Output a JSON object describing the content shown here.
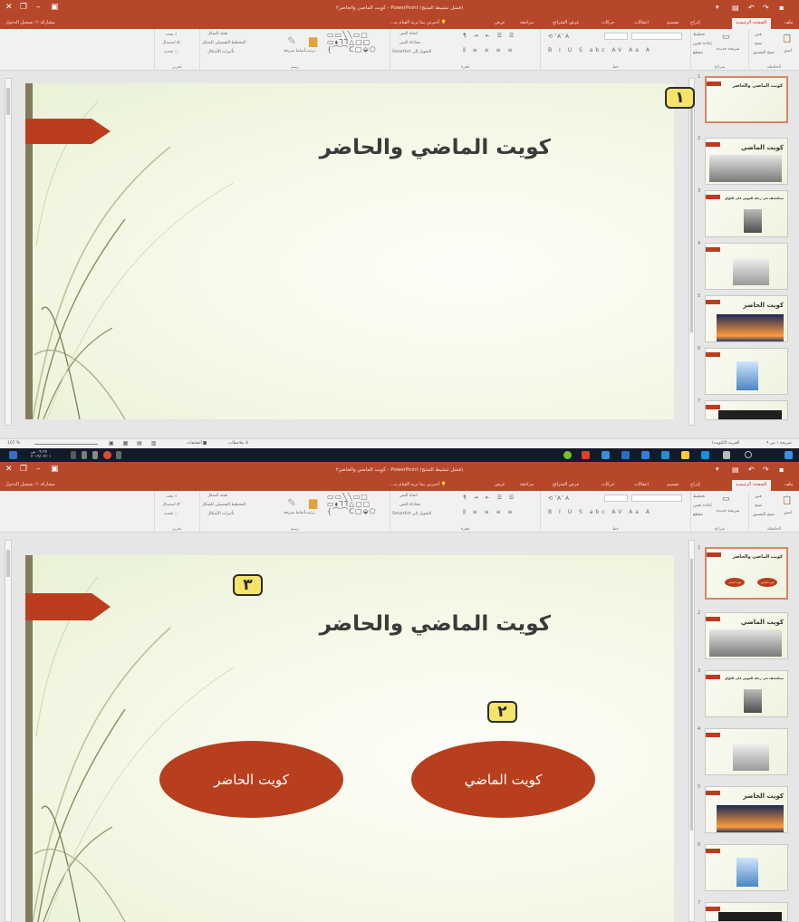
{
  "app": {
    "window_title": "كويت الماضي والحاضر۲ - PowerPoint (فشل تنشيط المنتج)",
    "sign_in": "تسجيل الدخول",
    "share": "مشاركة",
    "tell_me": "أخبرني بما تريد القيام به...",
    "file_tab": "ملف",
    "tabs": [
      "الصفحة الرئيسية",
      "إدراج",
      "تصميم",
      "انتقالات",
      "حركات",
      "عرض الشرائح",
      "مراجعة",
      "عرض"
    ]
  },
  "ribbon": {
    "groups": [
      "الحافظة",
      "شرائح",
      "خط",
      "فقرة",
      "رسم",
      "تحرير"
    ],
    "clipboard": {
      "paste": "لصق",
      "cut": "قص",
      "copy": "نسخ",
      "format_painter": "نسخ التنسيق"
    },
    "slides": {
      "new_slide": "شريحة جديدة",
      "layout": "تخطيط",
      "reset": "إعادة تعيين",
      "section": "مقطع"
    },
    "paragraph": {
      "text_direction": "اتجاه النص",
      "align_text": "محاذاة النص",
      "convert_smartart": "التحويل إلى SmartArt"
    },
    "drawing": {
      "arrange": "ترتيب",
      "quick_styles": "أنماط سريعة",
      "shape_fill": "تعبئة الشكل",
      "shape_outline": "المخطط التفصيلي للشكل",
      "shape_effects": "تأثيرات الأشكال"
    },
    "editing": {
      "find": "بحث",
      "replace": "استبدال",
      "select": "تحديد"
    }
  },
  "slide": {
    "title": "كويت الماضي والحاضر",
    "oval_past": "كويت الماضي",
    "oval_present": "كويت الحاضر"
  },
  "badges": {
    "one": "١",
    "two": "٢",
    "three": "٣"
  },
  "thumbnails": {
    "t1_title": "كويت الماضي والحاضر",
    "t2_title": "كويت الماضي",
    "t3_title": "سنكتشف في رحلة الغوص على اللؤلؤ",
    "t5_title": "كويت الحاضر",
    "mini_past": "كويت الماضي",
    "mini_present": "كويت الحاضر",
    "numbers": [
      "1",
      "2",
      "3",
      "4",
      "5",
      "6",
      "7"
    ]
  },
  "status": {
    "slide_counter": "شريحة ١ من ٩",
    "language": "العربية (الكويت)",
    "notes": "ملاحظات",
    "comments": "التعليقات",
    "zoom": "107 %"
  },
  "taskbar": {
    "time": "٠٩:٣٧ ص",
    "date": "٢٠١٩/٠٢/٠١"
  },
  "colors": {
    "titlebar": "#b7472a",
    "accent_orange": "#bb3d1f",
    "oval_fill": "#b73f1e",
    "badge_fill": "#f6e36a",
    "taskbar": "#151a2a"
  }
}
